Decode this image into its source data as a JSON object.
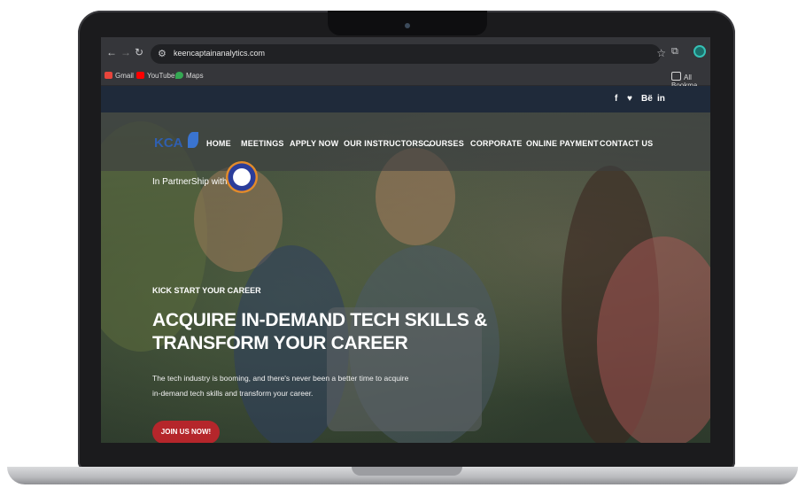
{
  "browser": {
    "url": "keencaptainanalytics.com",
    "bookmarks": [
      "Gmail",
      "YouTube",
      "Maps"
    ],
    "all_bookmarks": "All Bookma"
  },
  "site": {
    "logo_text": "KCA",
    "social": [
      "f",
      "♥",
      "Bë",
      "in"
    ],
    "menu": [
      "HOME",
      "MEETINGS",
      "APPLY NOW",
      "OUR INSTRUCTORS ⌄",
      "COURSES",
      "CORPORATE",
      "ONLINE PAYMENT",
      "CONTACT US"
    ],
    "partner_text": "In PartnerShip with",
    "kicker": "KICK START YOUR CAREER",
    "headline_line1": "ACQUIRE IN-DEMAND TECH SKILLS &",
    "headline_line2": "TRANSFORM YOUR CAREER",
    "paragraph": "The tech industry is booming, and there's never been a better time to acquire in-demand tech skills and transform your career.",
    "cta": "JOIN US NOW!"
  },
  "colors": {
    "accent_red": "#b5262b",
    "brand_blue": "#2f5fb0"
  }
}
